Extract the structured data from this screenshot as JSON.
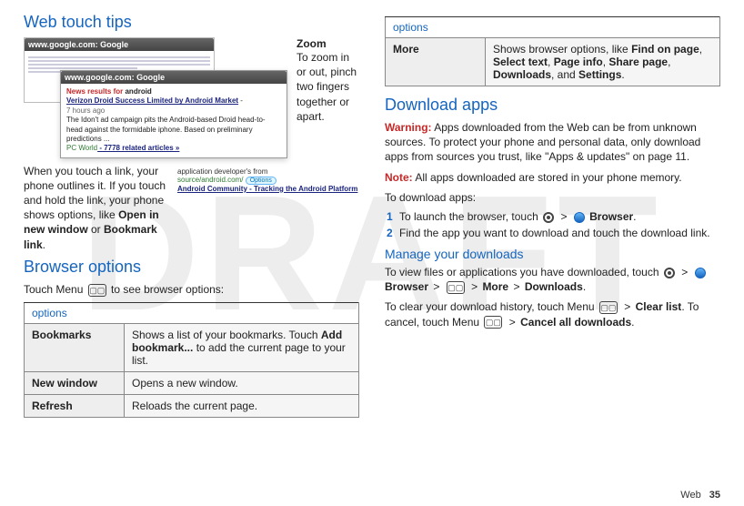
{
  "watermark": "DRAFT",
  "left": {
    "heading": "Web touch tips",
    "mock_url": "www.google.com: Google",
    "zoom_title": "Zoom",
    "zoom_body": "To zoom in or out, pinch two fingers together or apart.",
    "popup_news_label": "News results for",
    "popup_news_bold": "android",
    "popup_headline": "Verizon Droid Success Limited by Android Market",
    "popup_time": "7 hours ago",
    "popup_excerpt": "The Idon't ad campaign pits the Android-based Droid head-to-head against the formidable iphone. Based on preliminary predictions ...",
    "popup_src": "PC World",
    "popup_related": " - 7778 related articles »",
    "snippet_dev": "application developer's from",
    "snippet_src": "source/android.com/",
    "snippet_options": "Options",
    "snippet_link_pre": "Android",
    "snippet_link_post": " Community - Tracking the ",
    "snippet_link_end": "Android Platform",
    "touch_text_pre": "When you touch a link, your phone outlines it. If you touch and hold the link, your phone shows options, like ",
    "touch_bold_1": "Open in new window",
    "touch_mid": " or ",
    "touch_bold_2": "Bookmark link",
    "touch_end": ".",
    "browser_heading": "Browser options",
    "browser_intro_pre": "Touch Menu ",
    "browser_intro_post": " to see browser options:",
    "table1_header": "options",
    "table1": [
      {
        "k": "Bookmarks",
        "v_pre": "Shows a list of your bookmarks. Touch ",
        "v_b": "Add bookmark...",
        "v_post": " to add the current page to your list."
      },
      {
        "k": "New window",
        "v": "Opens a new window."
      },
      {
        "k": "Refresh",
        "v": "Reloads the current page."
      }
    ]
  },
  "right": {
    "table2_header": "options",
    "table2_label": "More",
    "table2_pre": "Shows browser options, like ",
    "table2_b1": "Find on page",
    "table2_c1": ", ",
    "table2_b2": "Select text",
    "table2_c2": ", ",
    "table2_b3": "Page info",
    "table2_c3": ", ",
    "table2_b4": "Share page",
    "table2_c4": ", ",
    "table2_b5": "Downloads",
    "table2_c5": ", and ",
    "table2_b6": "Settings",
    "table2_end": ".",
    "dl_heading": "Download apps",
    "warn_label": "Warning:",
    "warn_body": " Apps downloaded from the Web can be from unknown sources. To protect your phone and personal data, only download apps from sources you trust, like \"Apps & updates\" on page 11.",
    "note_label": "Note:",
    "note_body": " All apps downloaded are stored in your phone memory.",
    "dl_intro": "To download apps:",
    "step1_pre": "To launch the browser, touch ",
    "step1_gt": ">",
    "step1_b": "Browser",
    "step1_end": ".",
    "step2": "Find the app you want to download and touch the download link.",
    "manage_heading": "Manage your downloads",
    "manage_p_pre": "To view files or applications you have downloaded, touch ",
    "manage_p_b1": "Browser",
    "manage_p_b2": "More",
    "manage_p_b3": "Downloads",
    "manage_p_end": ".",
    "clear_pre": "To clear your download history, touch Menu ",
    "clear_b1": "Clear list",
    "clear_mid": ". To cancel, touch Menu ",
    "clear_b2": "Cancel all downloads",
    "clear_end": "."
  },
  "footer_section": "Web",
  "footer_page": "35"
}
